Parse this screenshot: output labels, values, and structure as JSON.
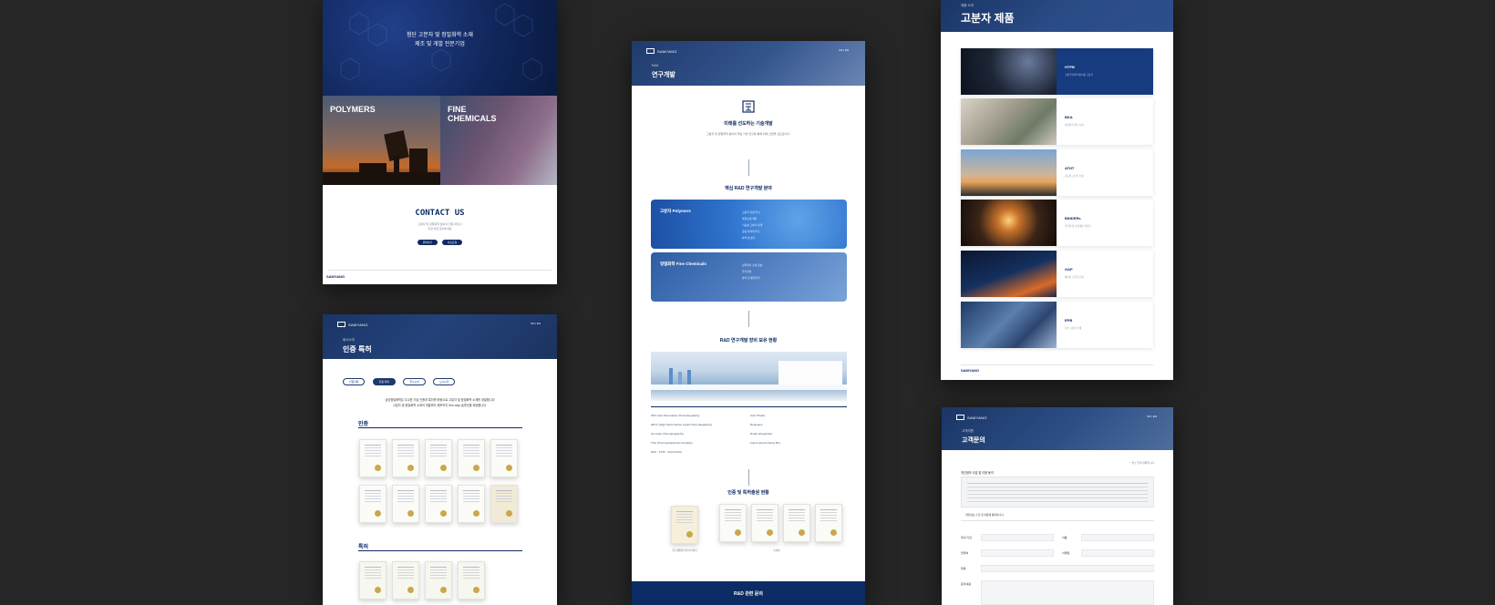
{
  "brand": "SAMYANG",
  "lang": "KR | EN",
  "home": {
    "hero_line1": "첨단 고분자 및 정밀화학 소재",
    "hero_line2": "제조 및 개발 전문기업",
    "tile_polymers": "POLYMERS",
    "tile_fine_chemicals": "FINE CHEMICALS",
    "contact_title": "CONTACT US",
    "contact_desc1": "고분자 및 정밀화학 분야의 전문 파트너",
    "contact_desc2": "지금 바로 문의하세요",
    "contact_btn1": "문의하기",
    "contact_btn2": "자료요청"
  },
  "certs": {
    "crumb": "회사소개",
    "title": "인증 특허",
    "tabs": [
      "인증현황",
      "인증·특허",
      "연구시설",
      "오시는길"
    ],
    "intro1": "삼양정밀화학은 우수한 기술 인증과 특허를 바탕으로 고분자 및 정밀화학 소재를 개발합니다",
    "intro2": "고분자 및 정밀화학 소재의 개발부터 제조까지 One-stop 솔루션을 제공합니다.",
    "section_certs": "인증",
    "section_patents": "특허"
  },
  "rnd": {
    "crumb": "R&D",
    "title": "연구개발",
    "headline": "미래를 선도하는 기술개발",
    "intro": "고분자 및 정밀화학 분야의 핵심 기술 연구를 통해 미래 산업을 선도합니다.",
    "core_title": "핵심 R&D 연구개발 분야",
    "panel1_label": "고분자 Polymers",
    "panel1_items": [
      "고분자 합성 연구",
      "복합소재 개발",
      "기능성 고분자 설계",
      "공정 최적화 연구",
      "분석 및 평가"
    ],
    "panel2_label": "정밀화학 Fine Chemicals",
    "panel2_items": [
      "정밀화학 소재 합성",
      "유기합성",
      "분석 및 품질관리"
    ],
    "equip_title": "R&D 연구개발 장비 보유 현황",
    "equip_left": [
      "GPC (Gel Permeation Chromatography)",
      "HPLC (High Performance Liquid Chromatography)",
      "GC (Gas Chromatography)",
      "TGA (Thermogravimetric Analysis)",
      "DSC · FTIR · Karl Fischer"
    ],
    "equip_right": [
      "Auto Titrator",
      "Rotavapor",
      "Rotary Evaporator",
      "Fume Hood & Glove Box"
    ],
    "cert_title": "인증 및 특허출원 현황",
    "cert_caption1": "연구개발전담부서 인정서",
    "cert_caption2": "특허증",
    "cta": "R&D 관련 문의"
  },
  "products": {
    "crumb": "제품 소개",
    "title": "고분자 제품",
    "items": [
      {
        "name": "HTPB",
        "desc": "고체 추진제 바인더용 고분자"
      },
      {
        "name": "BKA",
        "desc": "정밀화학 원료 소재"
      },
      {
        "name": "ATHT",
        "desc": "기능성 고분자 소재"
      },
      {
        "name": "BINDERs",
        "desc": "추진제 및 복합재용 바인더"
      },
      {
        "name": "GAP",
        "desc": "에너지 고분자 소재"
      },
      {
        "name": "EPB",
        "desc": "특수 고분자 소재"
      }
    ]
  },
  "inquiry": {
    "crumb": "고객지원",
    "title": "고객문의",
    "required_note": "* 필수 입력 항목입니다.",
    "privacy_title": "개인정보 수집 및 이용 동의",
    "agree_label": "개인정보 수집 및 이용에 동의합니다.",
    "fields": [
      "회사/기관",
      "이름",
      "연락처",
      "이메일",
      "제목",
      "문의내용"
    ]
  }
}
